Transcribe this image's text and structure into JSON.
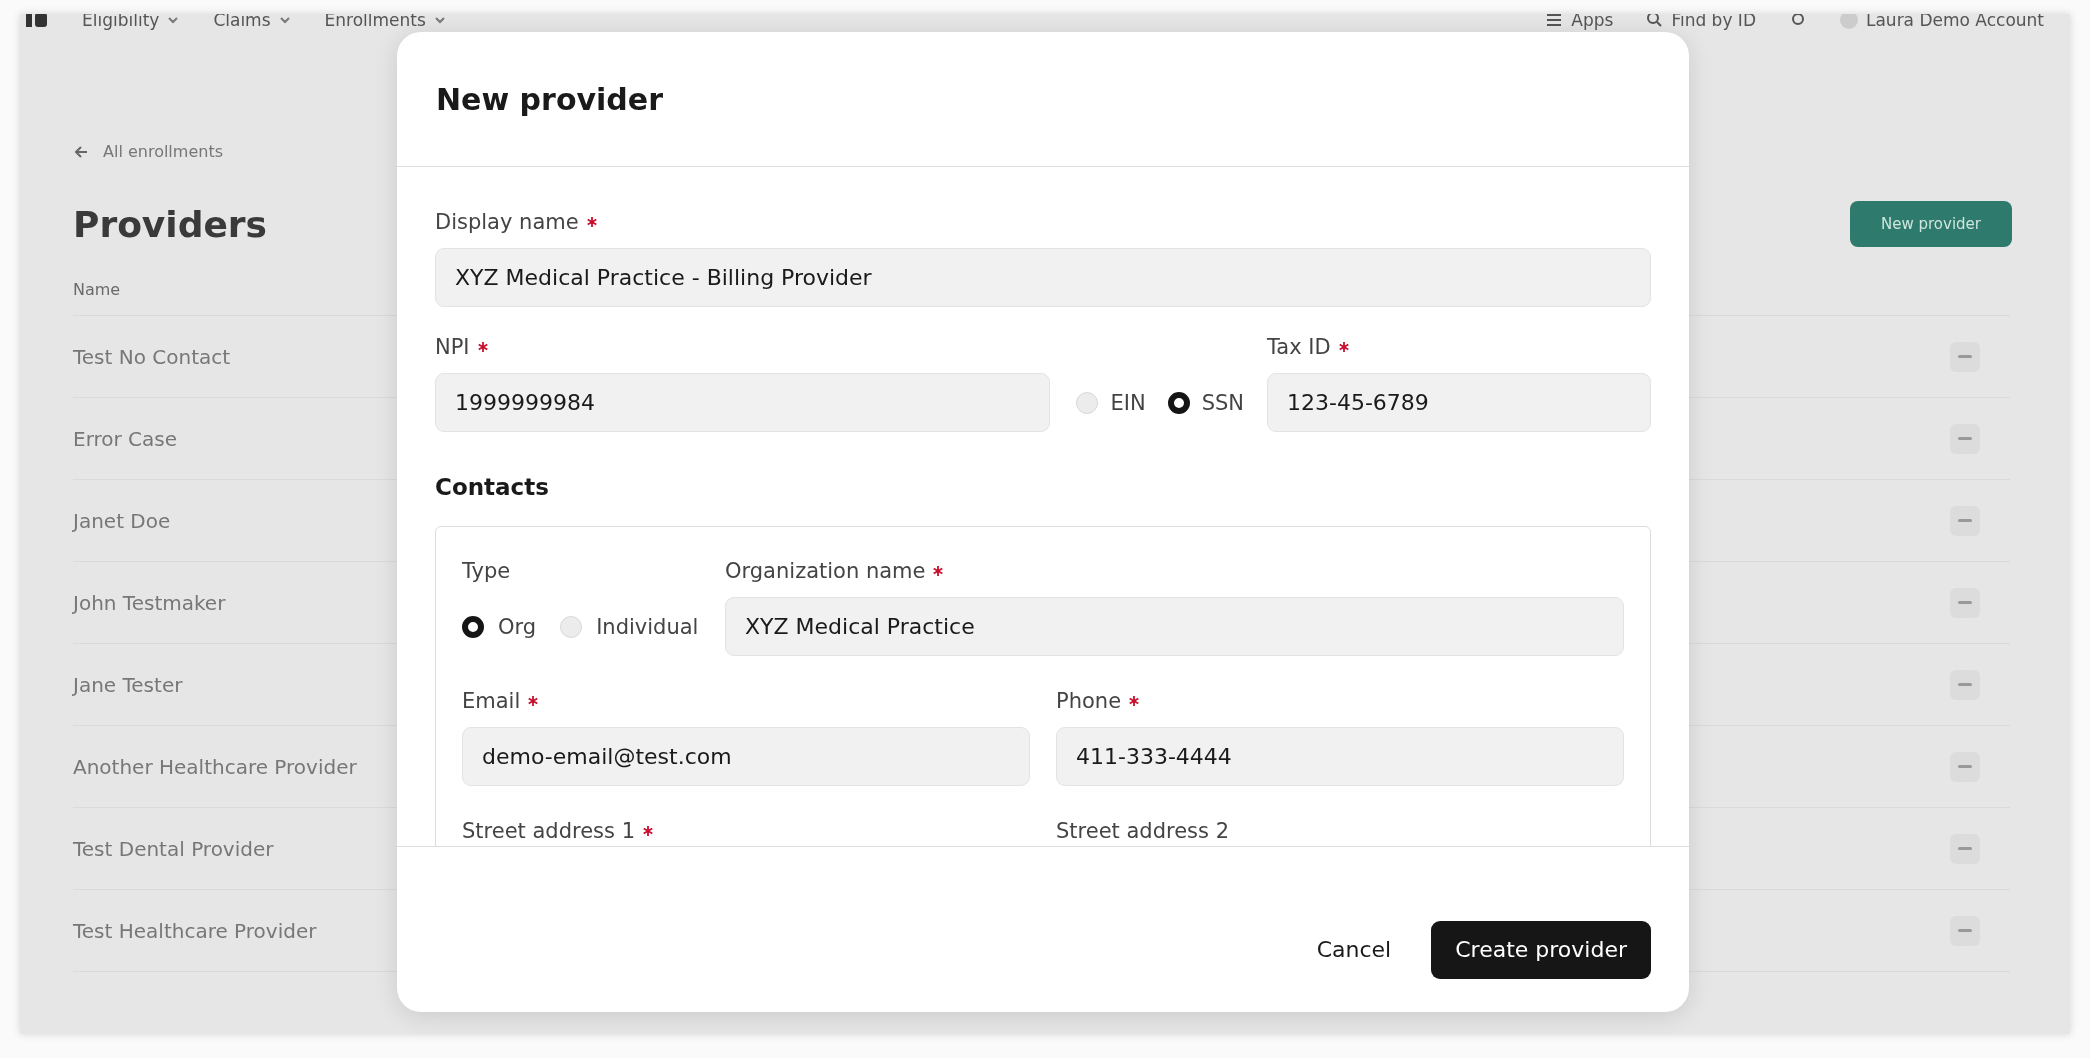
{
  "nav": {
    "menus": [
      {
        "label": "Eligibility"
      },
      {
        "label": "Claims"
      },
      {
        "label": "Enrollments"
      }
    ],
    "apps": "Apps",
    "find": "Find by ID",
    "account": "Laura Demo Account"
  },
  "page": {
    "back_link": "All enrollments",
    "title": "Providers",
    "new_button": "New provider",
    "table": {
      "columns": [
        "Name"
      ],
      "rows": [
        {
          "name": "Test No Contact"
        },
        {
          "name": "Error Case"
        },
        {
          "name": "Janet Doe"
        },
        {
          "name": "John Testmaker"
        },
        {
          "name": "Jane Tester"
        },
        {
          "name": "Another Healthcare Provider"
        },
        {
          "name": "Test Dental Provider"
        },
        {
          "name": "Test Healthcare Provider"
        }
      ]
    }
  },
  "dialog": {
    "title": "New provider",
    "display_name": {
      "label": "Display name",
      "required": true,
      "value": "XYZ Medical Practice - Billing Provider"
    },
    "npi": {
      "label": "NPI",
      "required": true,
      "value": "1999999984"
    },
    "tax_id_type": [
      {
        "label": "EIN",
        "selected": false
      },
      {
        "label": "SSN",
        "selected": true
      }
    ],
    "tax_id": {
      "label": "Tax ID",
      "required": true,
      "value": "123-45-6789"
    },
    "contacts": {
      "heading": "Contacts",
      "type_label": "Type",
      "type_options": [
        {
          "label": "Org",
          "selected": true
        },
        {
          "label": "Individual",
          "selected": false
        }
      ],
      "organization_name": {
        "label": "Organization name",
        "required": true,
        "value": "XYZ Medical Practice"
      },
      "email": {
        "label": "Email",
        "required": true,
        "value": "demo-email@test.com"
      },
      "phone": {
        "label": "Phone",
        "required": true,
        "value": "411-333-4444"
      },
      "street_address_1": {
        "label": "Street address 1",
        "required": true
      },
      "street_address_2": {
        "label": "Street address 2",
        "required": false
      }
    },
    "cancel": "Cancel",
    "submit": "Create provider"
  }
}
